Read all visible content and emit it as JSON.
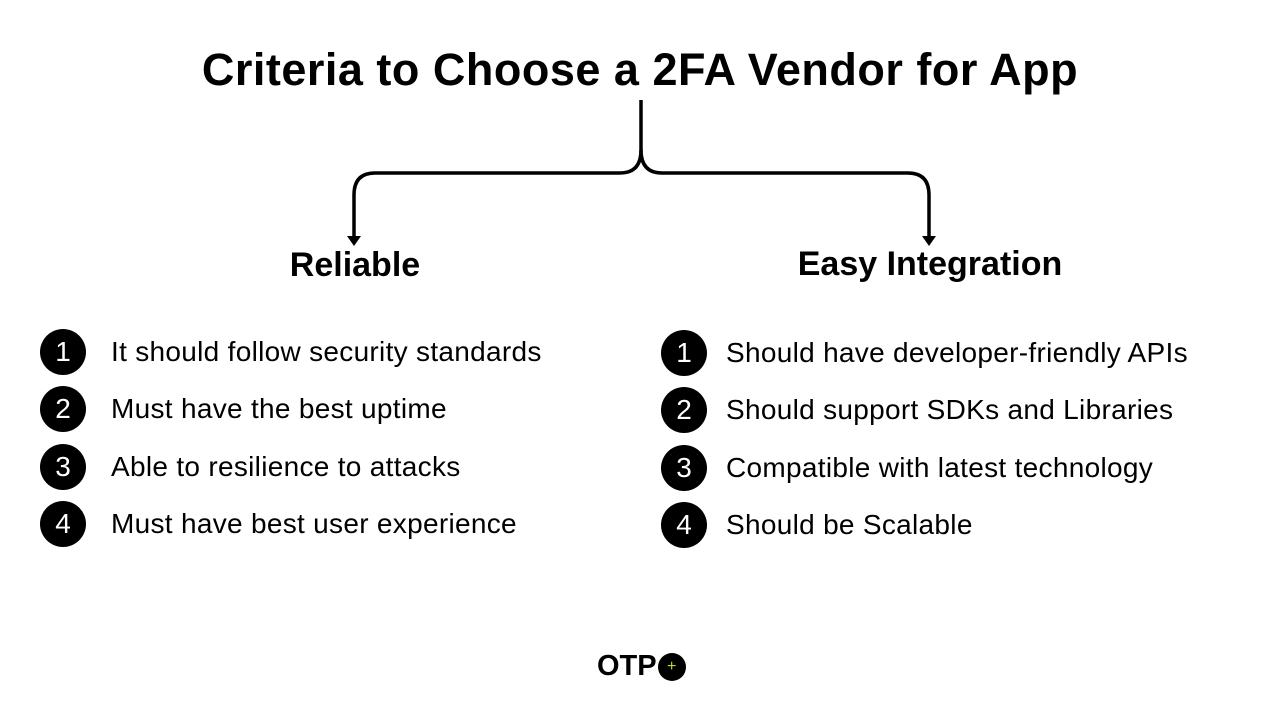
{
  "title": "Criteria to Choose a 2FA Vendor for App",
  "left_column": {
    "heading": "Reliable",
    "items": [
      {
        "number": "1",
        "text": "It should follow security standards"
      },
      {
        "number": "2",
        "text": "Must have the best uptime"
      },
      {
        "number": "3",
        "text": "Able to resilience to attacks"
      },
      {
        "number": "4",
        "text": "Must have best user experience"
      }
    ]
  },
  "right_column": {
    "heading": "Easy Integration",
    "items": [
      {
        "number": "1",
        "text": "Should have developer-friendly APIs"
      },
      {
        "number": "2",
        "text": "Should support SDKs and Libraries"
      },
      {
        "number": "3",
        "text": "Compatible with latest technology"
      },
      {
        "number": "4",
        "text": "Should be Scalable"
      }
    ]
  },
  "logo": {
    "text": "OTP",
    "mark": "+",
    "accent_color": "#c6d62a"
  }
}
